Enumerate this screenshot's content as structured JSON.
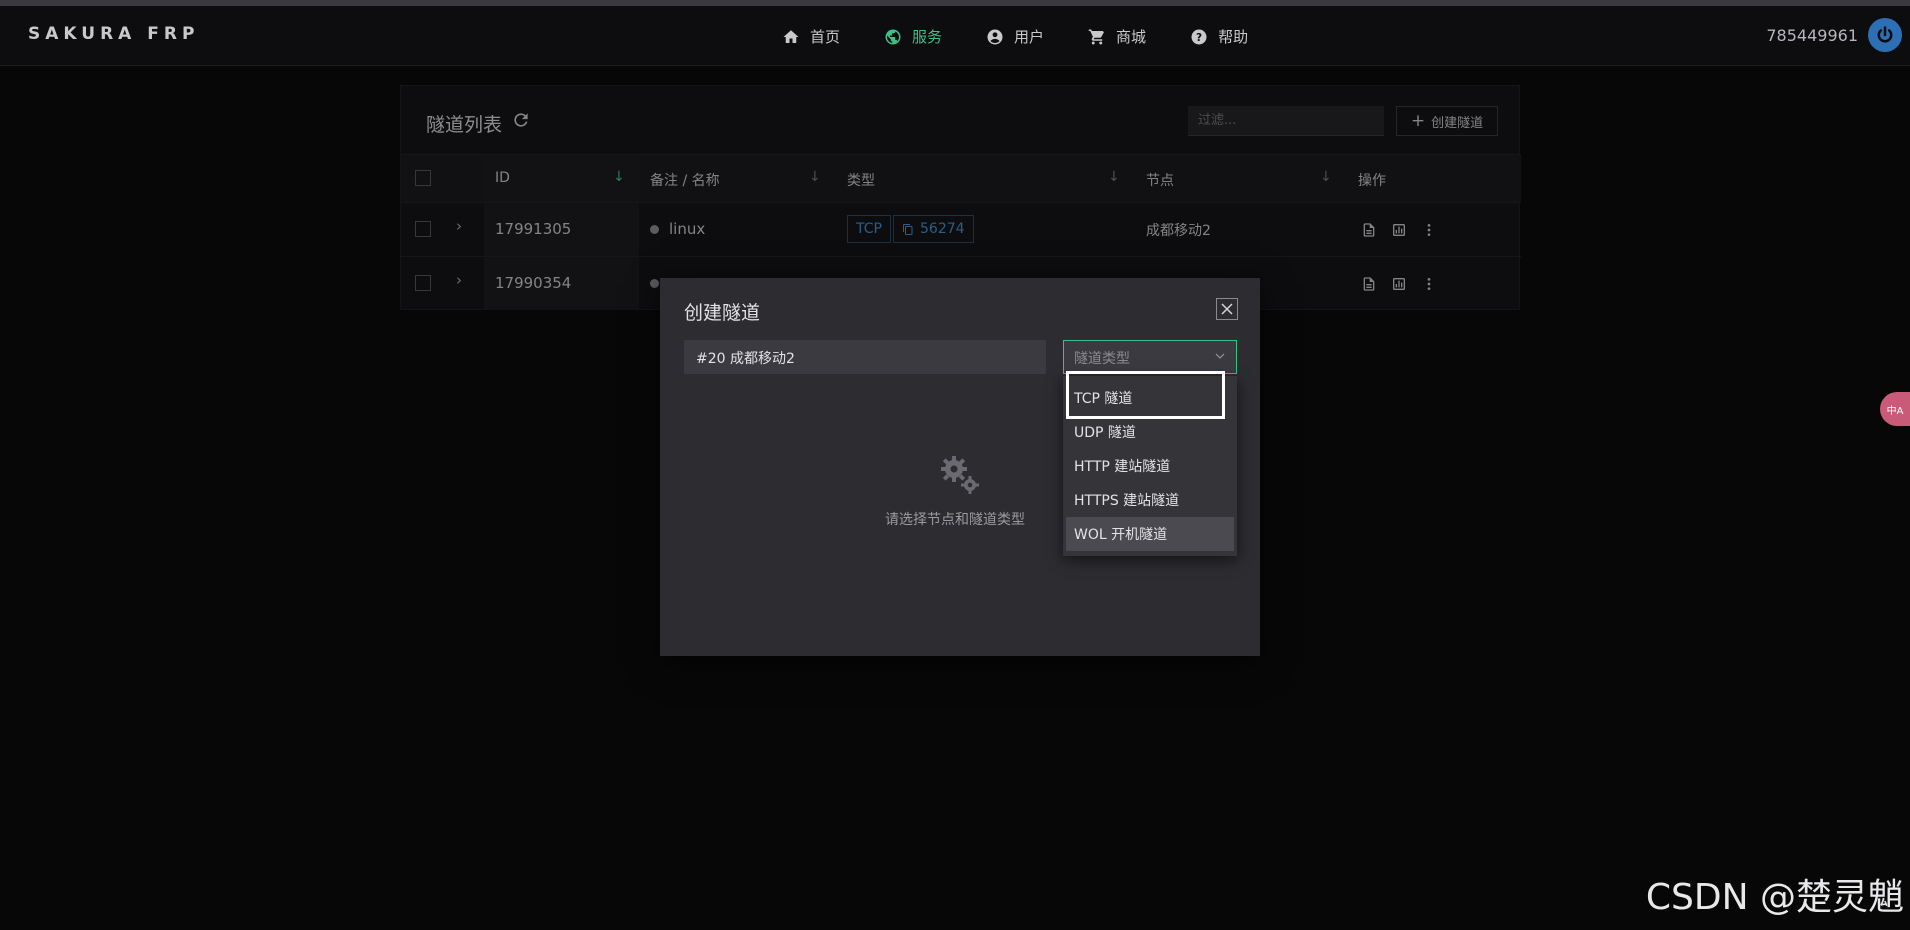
{
  "brand": "SAKURA FRP",
  "nav": {
    "items": [
      {
        "label": "首页",
        "icon": "home-icon"
      },
      {
        "label": "服务",
        "icon": "globe-icon",
        "active": true
      },
      {
        "label": "用户",
        "icon": "account-circle-icon"
      },
      {
        "label": "商城",
        "icon": "cart-icon"
      },
      {
        "label": "帮助",
        "icon": "help-circle-icon"
      }
    ],
    "user_id": "785449961",
    "power_icon": "power-icon"
  },
  "card": {
    "title": "隧道列表",
    "refresh_icon": "refresh-icon",
    "filter_placeholder": "过滤...",
    "create_button": "创建隧道",
    "columns": [
      "ID",
      "备注 / 名称",
      "类型",
      "节点",
      "操作"
    ],
    "rows": [
      {
        "id": "17991305",
        "name": "linux",
        "type": "TCP",
        "port": "56274",
        "node": "成都移动2"
      },
      {
        "id": "17990354",
        "name": "",
        "type": "",
        "port": "",
        "node": ""
      }
    ]
  },
  "modal": {
    "title": "创建隧道",
    "node_value": "#20 成都移动2",
    "type_placeholder": "隧道类型",
    "empty_text": "请选择节点和隧道类型",
    "options": [
      "TCP 隧道",
      "UDP 隧道",
      "HTTP 建站隧道",
      "HTTPS 建站隧道",
      "WOL 开机隧道"
    ],
    "highlighted_option_index": 0,
    "hovered_option_index": 4
  },
  "side_badge": "中A",
  "watermark": "CSDN @楚灵魈",
  "colors": {
    "accent": "#3fbf86",
    "link": "#3f8fd8",
    "background": "#0b0b0d",
    "modal_bg": "#2c2c31"
  }
}
